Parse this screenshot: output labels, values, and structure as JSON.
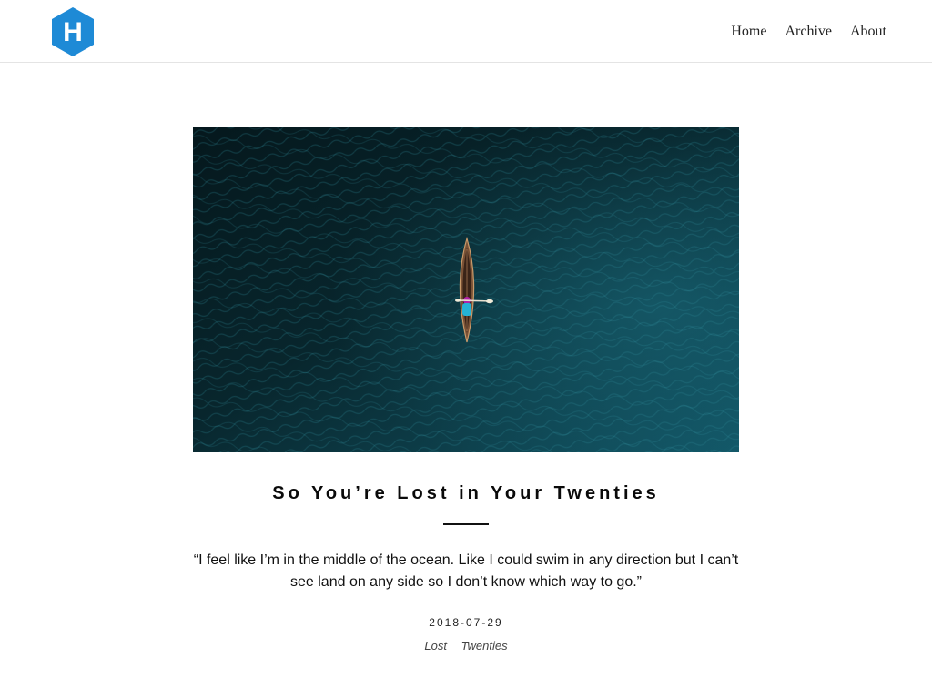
{
  "header": {
    "logo_letter": "H",
    "logo_color": "#1e8ad6",
    "nav": [
      {
        "label": "Home"
      },
      {
        "label": "Archive"
      },
      {
        "label": "About"
      }
    ]
  },
  "post": {
    "title": "So You’re Lost in Your Twenties",
    "excerpt": "“I feel like I’m in the middle of the ocean. Like I could swim in any direction but I can’t see land on any side so I don’t know which way to go.”",
    "date": "2018-07-29",
    "tags": [
      {
        "label": "Lost"
      },
      {
        "label": "Twenties"
      }
    ]
  },
  "colors": {
    "ocean_dark": "#061e24",
    "ocean_light": "#114f5c"
  }
}
